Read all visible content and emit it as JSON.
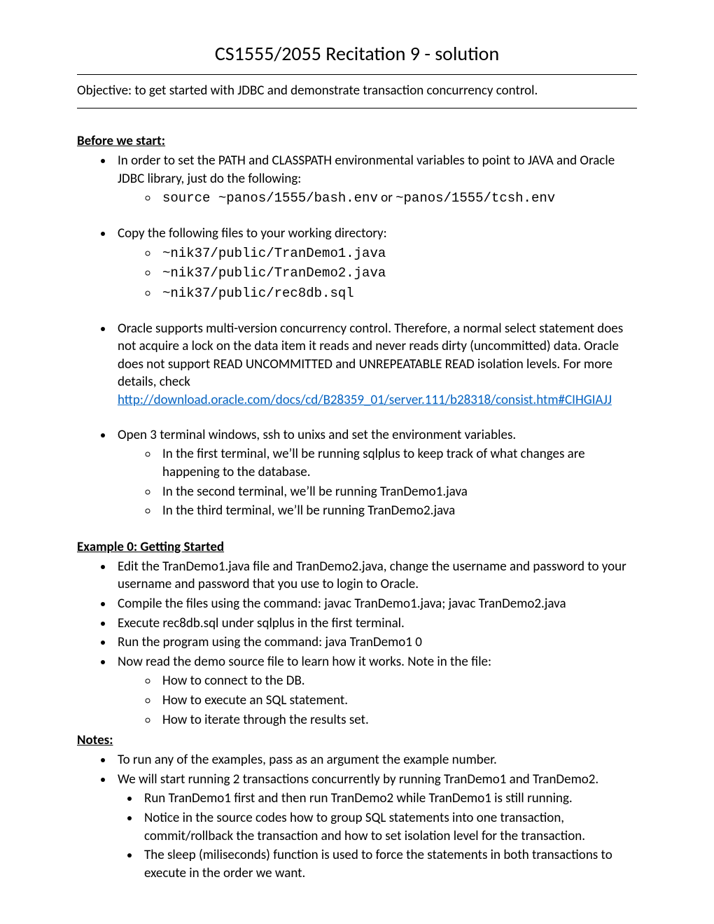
{
  "title": "CS1555/2055 Recitation 9 - solution",
  "objective": "Objective:  to get started with JDBC and demonstrate transaction concurrency control.",
  "sections": {
    "before": {
      "heading": "Before we start:",
      "b1": {
        "text": "In order to set the PATH and CLASSPATH environmental variables to point to JAVA and Oracle JDBC library, just do the following:",
        "s1_prefix": "source ",
        "s1_code1": "~panos/1555/bash.env",
        "s1_mid": " or ",
        "s1_code2": "~panos/1555/tcsh.env"
      },
      "b2": {
        "text": "Copy the following files to your working directory:",
        "s1": "~nik37/public/TranDemo1.java",
        "s2": "~nik37/public/TranDemo2.java",
        "s3": "~nik37/public/rec8db.sql"
      },
      "b3": {
        "text": "Oracle supports multi-version concurrency control. Therefore, a normal select statement does not acquire a lock on the data item it reads and never reads dirty (uncommitted) data. Oracle does not support READ UNCOMMITTED and UNREPEATABLE READ isolation levels. For more details, check",
        "link": "http://download.oracle.com/docs/cd/B28359_01/server.111/b28318/consist.htm#CIHGIAJJ"
      },
      "b4": {
        "text": "Open 3 terminal windows, ssh to unixs and set the environment variables.",
        "s1": "In the first terminal, we’ll be running sqlplus to keep track of what changes are happening to the database.",
        "s2": "In the second terminal, we’ll be running TranDemo1.java",
        "s3": "In the third terminal, we’ll be running TranDemo2.java"
      }
    },
    "example0": {
      "heading": "Example 0: Getting Started ",
      "b1": "Edit the TranDemo1.java file and TranDemo2.java, change the username and password to your username and password that you use to login to Oracle.",
      "b2": "Compile the files using the command: javac TranDemo1.java; javac TranDemo2.java",
      "b3": "Execute rec8db.sql under sqlplus in the first terminal.",
      "b4": "Run the program using the command: java TranDemo1 0",
      "b5": {
        "text": "Now read the demo source file to learn how it works. Note in the file:",
        "s1": "How to connect to the DB.",
        "s2": "How to execute an SQL statement.",
        "s3": "How to iterate through the results set."
      }
    },
    "notes": {
      "heading": "Notes: ",
      "b1": "To run any of the examples, pass as an argument the example number.",
      "b2": {
        "text": "We will start running 2 transactions concurrently by running TranDemo1 and TranDemo2.",
        "s1": "Run TranDemo1 first and then run TranDemo2 while TranDemo1 is still running.",
        "s2": "Notice in the source codes how to group SQL statements into one transaction, commit/rollback the transaction and how to set isolation level for the transaction.",
        "s3": "The sleep (miliseconds) function is used to force the statements in both transactions to execute in the order we want."
      }
    }
  }
}
